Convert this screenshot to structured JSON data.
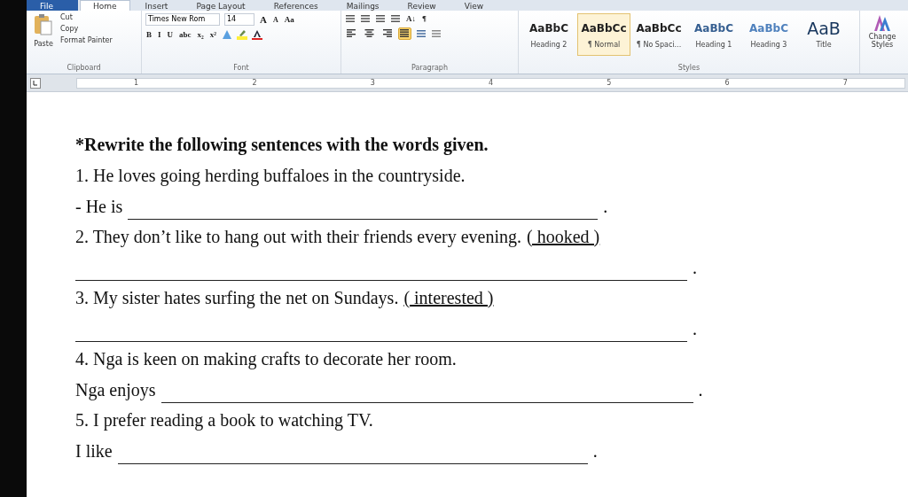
{
  "tabs": [
    {
      "label": "File",
      "kind": "file",
      "selected": false
    },
    {
      "label": "Home",
      "kind": "tab",
      "selected": true
    },
    {
      "label": "Insert",
      "kind": "tab",
      "selected": false
    },
    {
      "label": "Page Layout",
      "kind": "tab",
      "selected": false
    },
    {
      "label": "References",
      "kind": "tab",
      "selected": false
    },
    {
      "label": "Mailings",
      "kind": "tab",
      "selected": false
    },
    {
      "label": "Review",
      "kind": "tab",
      "selected": false
    },
    {
      "label": "View",
      "kind": "tab",
      "selected": false
    }
  ],
  "clipboard": {
    "paste": "Paste",
    "items": [
      "Cut",
      "Copy",
      "Format Painter"
    ],
    "label": "Clipboard"
  },
  "font": {
    "name": "Times New Rom",
    "size": "14",
    "grow": "A",
    "shrink": "A",
    "case": "Aa",
    "format_buttons": [
      "B",
      "I",
      "U",
      "abc",
      "x₂",
      "x²"
    ],
    "label": "Font"
  },
  "paragraph": {
    "alignments": [
      {
        "kind": "left",
        "selected": false
      },
      {
        "kind": "center",
        "selected": false
      },
      {
        "kind": "right",
        "selected": false
      },
      {
        "kind": "justify",
        "selected": true
      }
    ],
    "sort": "A↓",
    "pilcrow": "¶",
    "label": "Paragraph"
  },
  "styles": {
    "items": [
      {
        "preview": "AaBbC",
        "name": "Heading 2",
        "selected": false,
        "color": "#1f1f1f"
      },
      {
        "preview": "AaBbCc",
        "name": "¶ Normal",
        "selected": true,
        "color": "#1f1f1f"
      },
      {
        "preview": "AaBbCc",
        "name": "¶ No Spaci...",
        "selected": false,
        "color": "#1f1f1f"
      },
      {
        "preview": "AaBbC",
        "name": "Heading 1",
        "selected": false,
        "color": "#365f91"
      },
      {
        "preview": "AaBbC",
        "name": "Heading 3",
        "selected": false,
        "color": "#4f81bd"
      },
      {
        "preview": "AaB",
        "name": "Title",
        "selected": false,
        "color": "#17365d"
      }
    ],
    "label": "Styles",
    "change": "Change Styles"
  },
  "ruler": {
    "numbers": [
      "1",
      "2",
      "3",
      "4",
      "5",
      "6",
      "7"
    ]
  },
  "document": [
    {
      "kind": "title",
      "text": "*Rewrite the following sentences with the words given."
    },
    {
      "kind": "line",
      "text": "1. He loves going herding buffaloes in the countryside."
    },
    {
      "kind": "answer",
      "prefix": "- He is",
      "end": "."
    },
    {
      "kind": "line",
      "text": "2. They don’t like to hang out with their friends every evening.",
      "keyword": "( hooked )"
    },
    {
      "kind": "answer",
      "end": "."
    },
    {
      "kind": "line",
      "text": "3. My sister hates surfing the net on Sundays.",
      "keyword": "( interested )"
    },
    {
      "kind": "answer",
      "end": "."
    },
    {
      "kind": "line",
      "text": "4. Nga is keen on making crafts to decorate her room."
    },
    {
      "kind": "answer",
      "prefix": "Nga enjoys",
      "end": "."
    },
    {
      "kind": "line",
      "text": "5. I prefer reading a book to watching TV."
    },
    {
      "kind": "answer",
      "prefix": "I like",
      "end": "."
    }
  ]
}
